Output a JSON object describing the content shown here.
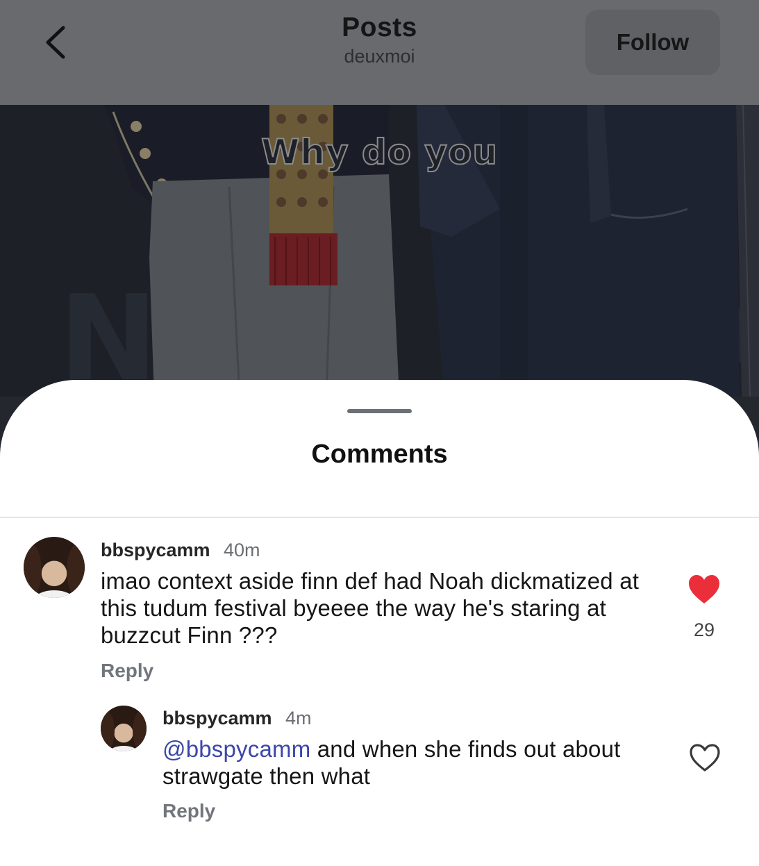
{
  "header": {
    "title": "Posts",
    "subtitle": "deuxmoi",
    "follow_label": "Follow"
  },
  "post": {
    "overlay_text": "Why do you"
  },
  "sheet": {
    "title": "Comments"
  },
  "comments": [
    {
      "username": "bbspycamm",
      "time": "40m",
      "text": "imao context aside finn def had Noah dickmatized at this tudum festival byeeee the way he's staring at buzzcut Finn ???",
      "reply_label": "Reply",
      "liked": true,
      "like_count": "29"
    },
    {
      "username": "bbspycamm",
      "time": "4m",
      "mention": "@bbspycamm",
      "text": " and when she finds out about strawgate then what",
      "reply_label": "Reply",
      "liked": false
    }
  ],
  "colors": {
    "header_bg": "#686a6e",
    "like_red": "#ea2f3a",
    "mention_blue": "#3b46a8"
  }
}
